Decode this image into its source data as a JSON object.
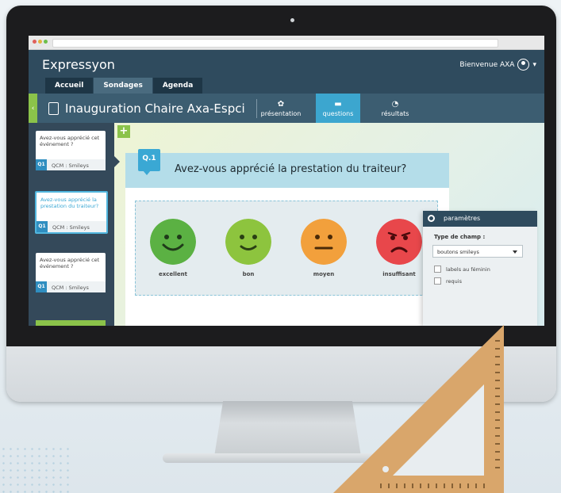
{
  "app": {
    "brand": "Expressyon",
    "welcome": "Bienvenue AXA",
    "tabs": [
      {
        "label": "Accueil",
        "active": false
      },
      {
        "label": "Sondages",
        "active": true
      },
      {
        "label": "Agenda",
        "active": false
      }
    ]
  },
  "survey": {
    "title": "Inauguration Chaire Axa-Espci",
    "nav": [
      {
        "label": "présentation",
        "icon": "gear-icon",
        "active": false
      },
      {
        "label": "questions",
        "icon": "speech-bubble-icon",
        "active": true
      },
      {
        "label": "résultats",
        "icon": "pie-chart-icon",
        "active": false
      }
    ]
  },
  "questions": [
    {
      "text": "Avez-vous apprécié cet événement ?",
      "badge": "Q1",
      "type": "QCM : Smileys",
      "active": false
    },
    {
      "text": "Avez-vous apprécié la prestation du traiteur?",
      "badge": "Q1",
      "type": "QCM : Smileys",
      "active": true
    },
    {
      "text": "Avez-vous apprécié cet événement ?",
      "badge": "Q1",
      "type": "QCM : Smileys",
      "active": false
    }
  ],
  "add_label": "+",
  "current_question": {
    "number": "Q.1",
    "title": "Avez-vous apprécié la prestation du traiteur?",
    "answers": [
      {
        "label": "excellent",
        "color": "#5bb143",
        "mood": "very-happy"
      },
      {
        "label": "bon",
        "color": "#8dc43e",
        "mood": "happy"
      },
      {
        "label": "moyen",
        "color": "#f2a03c",
        "mood": "neutral"
      },
      {
        "label": "insuffisant",
        "color": "#e8474b",
        "mood": "sad"
      }
    ]
  },
  "params": {
    "title": "paramètres",
    "field_type_label": "Type de champ :",
    "field_type_value": "boutons smileys",
    "checkboxes": [
      {
        "label": "labels au féminin",
        "checked": false
      },
      {
        "label": "requis",
        "checked": false
      }
    ]
  },
  "colors": {
    "header": "#2f4b5e",
    "accent": "#3ca6cf",
    "green": "#8bc34a"
  }
}
